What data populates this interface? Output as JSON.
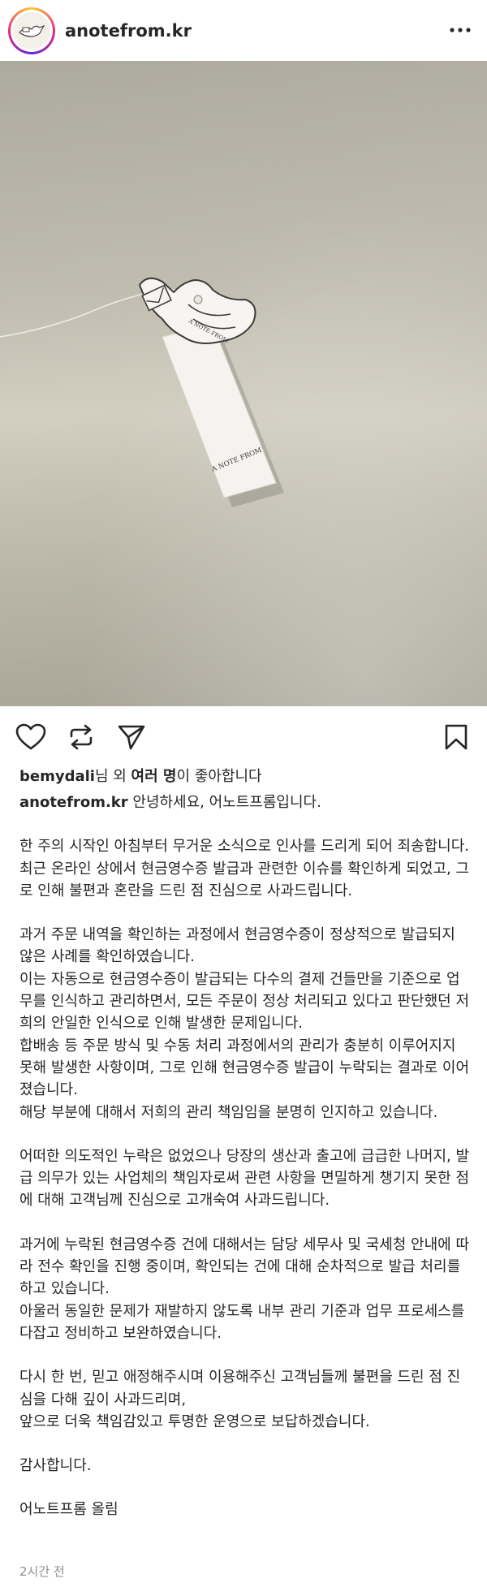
{
  "post": {
    "username": "anotefrom.kr",
    "tag_text": "A NOTE FROM",
    "tag_top_text": "A NOTE FROM"
  },
  "likes": {
    "user": "bemydali",
    "suffix1": "님 외 ",
    "bold": "여러 명",
    "suffix2": "이 좋아합니다"
  },
  "caption": {
    "username": "anotefrom.kr",
    "first_line": " 안녕하세요, 어노트프롬입니다.",
    "paragraphs": [
      "한 주의 시작인 아침부터 무거운 소식으로 인사를 드리게 되어 죄송합니다.\n최근 온라인 상에서 현금영수증 발급과 관련한 이슈를 확인하게 되었고, 그로 인해 불편과 혼란을 드린 점 진심으로 사과드립니다.",
      "과거 주문 내역을 확인하는 과정에서 현금영수증이 정상적으로 발급되지 않은 사례를 확인하였습니다.\n이는 자동으로 현금영수증이 발급되는 다수의 결제 건들만을 기준으로 업무를 인식하고 관리하면서, 모든 주문이 정상 처리되고 있다고 판단했던 저희의 안일한 인식으로 인해 발생한 문제입니다.\n합배송 등 주문 방식 및 수동 처리 과정에서의 관리가 충분히 이루어지지 못해 발생한 사항이며, 그로 인해 현금영수증 발급이 누락되는 결과로 이어졌습니다.\n해당 부분에 대해서 저희의 관리 책임임을 분명히 인지하고 있습니다.",
      "어떠한 의도적인 누락은 없었으나 당장의 생산과 출고에 급급한 나머지, 발급 의무가 있는 사업체의 책임자로써 관련 사항을 면밀하게 챙기지 못한 점에 대해 고객님께 진심으로 고개숙여 사과드립니다.",
      "과거에 누락된 현금영수증 건에 대해서는 담당 세무사 및 국세청 안내에 따라 전수 확인을 진행 중이며, 확인되는 건에 대해 순차적으로 발급 처리를 하고 있습니다.\n아울러 동일한 문제가 재발하지 않도록 내부 관리 기준과 업무 프로세스를 다잡고 정비하고 보완하였습니다.",
      "다시 한 번, 믿고 애정해주시며 이용해주신 고객님들께 불편을 드린 점 진심을 다해 깊이 사과드리며,\n앞으로 더욱 책임감있고 투명한 운영으로 보답하겠습니다.",
      "감사합니다.",
      "어노트프롬 올림"
    ]
  },
  "time_ago": "2시간 전",
  "colors": {
    "text": "#262626",
    "muted": "#8e8e8e",
    "wall": "#c8c5b8"
  }
}
